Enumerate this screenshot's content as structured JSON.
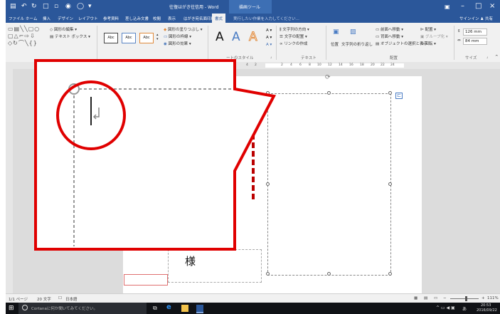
{
  "window": {
    "title": "往復はがき往信用 - Word",
    "context_tab_group": "描画ツール"
  },
  "tabs": [
    "ファイル",
    "ホーム",
    "挿入",
    "デザイン",
    "レイアウト",
    "参考資料",
    "差し込み文書",
    "校閲",
    "表示",
    "はがき宛名面印刷",
    "書式"
  ],
  "active_tab": "書式",
  "tell_me": "実行したい作業を入力してください...",
  "signin": "サインイン",
  "share": "共有",
  "ribbon": {
    "edit_shape": "図形の編集",
    "text_box": "テキスト ボックス",
    "style_box": "Abc",
    "shape_fill": "図形の塗りつぶし",
    "shape_outline": "図形の枠線",
    "shape_effects": "図形の効果",
    "wordart_letter": "A",
    "wordart_group_label": "ートのスタイル",
    "text_direction": "文字列の方向",
    "align_text": "文字の配置",
    "create_link": "リンクの作成",
    "text_group_label": "テキスト",
    "position": "位置",
    "wrap_text": "文字列の折り返し",
    "bring_forward": "前面へ移動",
    "send_backward": "背面へ移動",
    "selection_pane": "オブジェクトの選択と表示",
    "align": "配置",
    "group": "グループ化",
    "rotate": "回転",
    "arrange_group_label": "配置",
    "height_value": "126 mm",
    "width_value": "84 mm",
    "size_group_label": "サイズ"
  },
  "ruler": {
    "marks": [
      "4",
      "2",
      "2",
      "4",
      "6",
      "8",
      "10",
      "12",
      "14",
      "16",
      "18",
      "20",
      "22",
      "24"
    ]
  },
  "document": {
    "honorific": "様"
  },
  "status": {
    "page": "1/1 ページ",
    "words": "20 文字",
    "language": "日本語",
    "zoom": "111%"
  },
  "taskbar": {
    "cortana_placeholder": "Cortanaに何か聞いてみてください。",
    "ime": "あ",
    "time": "20:53",
    "date": "2016/09/22"
  },
  "colors": {
    "brand": "#2b579a",
    "callout": "#e00000"
  }
}
